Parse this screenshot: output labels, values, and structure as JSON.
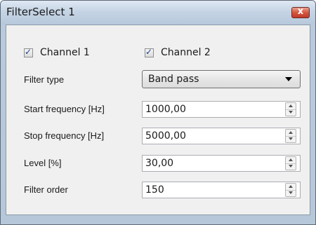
{
  "window": {
    "title": "FilterSelect 1",
    "close_icon": "close-icon"
  },
  "channels": [
    {
      "label": "Channel 1",
      "checked": true
    },
    {
      "label": "Channel 2",
      "checked": true
    }
  ],
  "filter_type": {
    "label": "Filter type",
    "value": "Band pass"
  },
  "fields": [
    {
      "label": "Start frequency [Hz]",
      "value": "1000,00"
    },
    {
      "label": "Stop frequency [Hz]",
      "value": "5000,00"
    },
    {
      "label": "Level [%]",
      "value": "30,00"
    },
    {
      "label": "Filter order",
      "value": "150"
    }
  ],
  "icons": {
    "check": "✓",
    "close": "x"
  },
  "colors": {
    "title_bar": "#c5d4e5",
    "close_button": "#d4563f",
    "panel": "#f0f0f0"
  }
}
